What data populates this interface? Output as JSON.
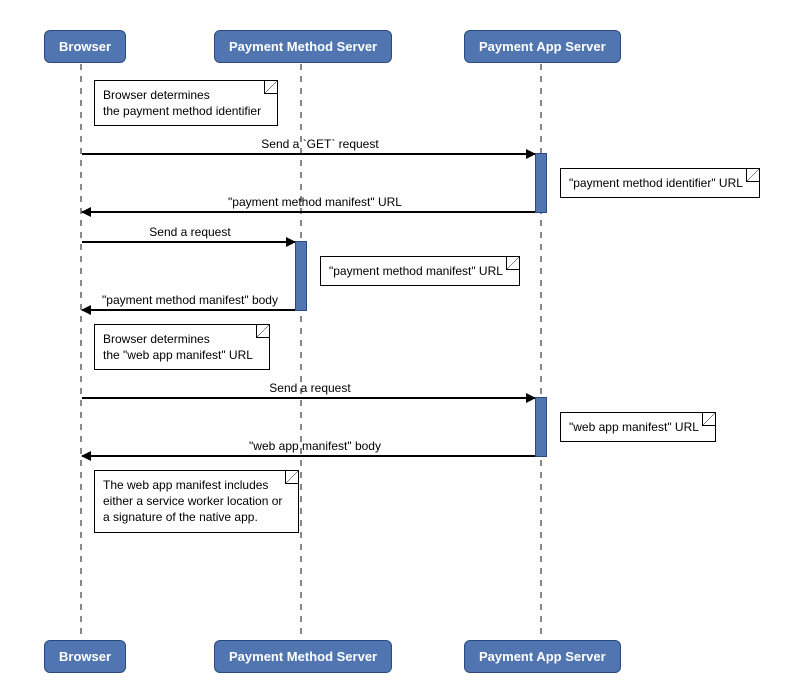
{
  "participants": {
    "browser": "Browser",
    "pms": "Payment Method Server",
    "pas": "Payment App Server"
  },
  "notes": {
    "n1": "Browser determines\nthe payment method identifier",
    "n2": "\"payment method identifier\" URL",
    "n3": "\"payment method manifest\" URL",
    "n4": "Browser determines\nthe \"web app manifest\" URL",
    "n5": "\"web app manifest\" URL",
    "n6": "The web app manifest includes\neither a service worker location or\na signature of the native app."
  },
  "messages": {
    "m1": "Send a `GET` request",
    "m2": "\"payment method manifest\" URL",
    "m3": "Send a request",
    "m4": "\"payment method manifest\" body",
    "m5": "Send a request",
    "m6": "\"web app manifest\" body"
  },
  "layout": {
    "x": {
      "browser": 60,
      "pms": 280,
      "pas": 520
    },
    "topBoxY": 10,
    "botBoxY": 620,
    "lifelineTop": 44,
    "lifelineBot": 620
  }
}
